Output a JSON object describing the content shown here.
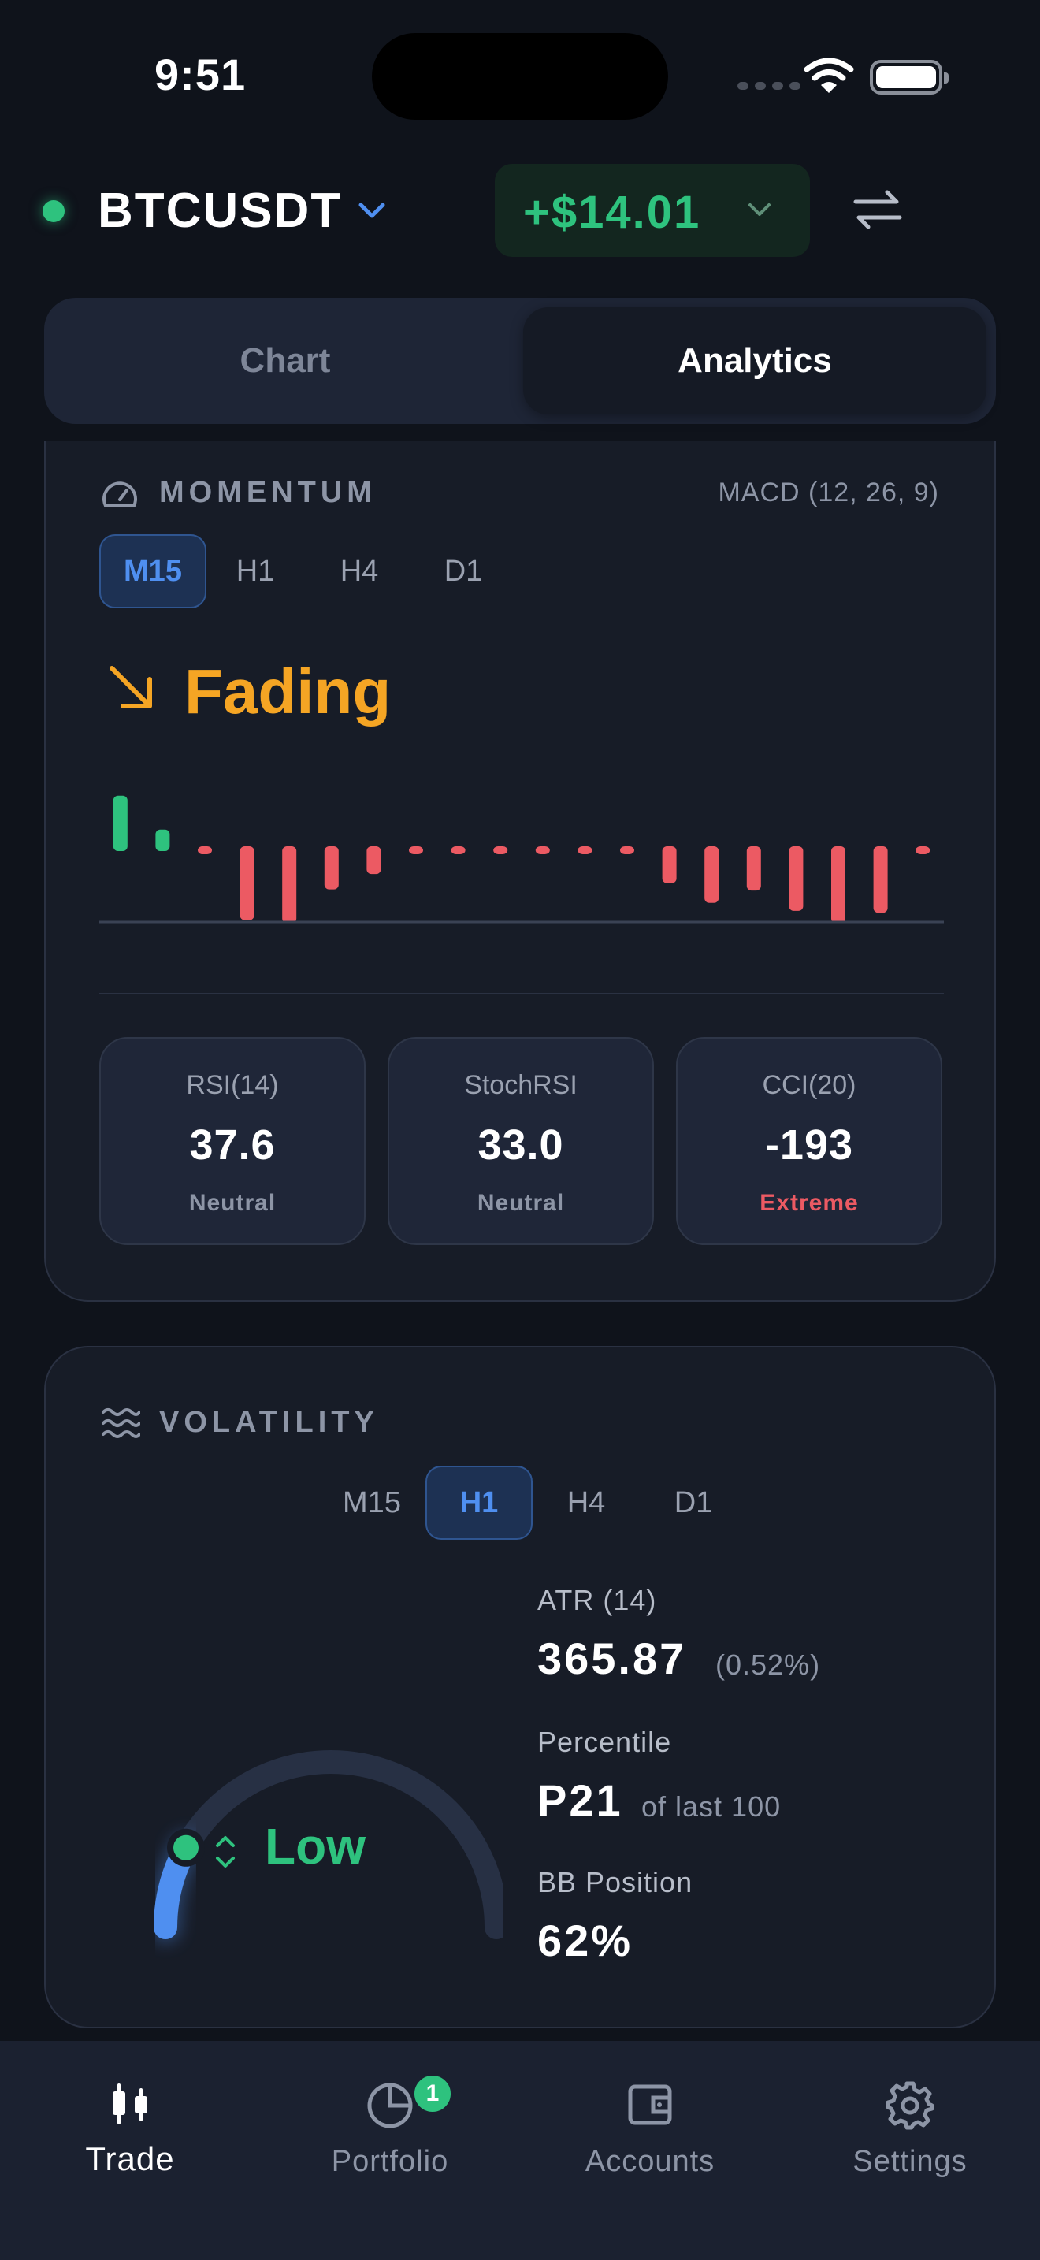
{
  "status_bar": {
    "time": "9:51"
  },
  "header": {
    "symbol": "BTCUSDT",
    "pnl": "+$14.01",
    "colors": {
      "live": "#2ec27e",
      "profit": "#2ec27e",
      "accent": "#4f8ff0"
    }
  },
  "segmented": {
    "items": [
      "Chart",
      "Analytics"
    ],
    "active": "Analytics"
  },
  "momentum": {
    "title": "MOMENTUM",
    "indicator": "MACD (12, 26, 9)",
    "timeframes": [
      "M15",
      "H1",
      "H4",
      "D1"
    ],
    "active_timeframe": "M15",
    "trend": "Fading",
    "trend_color": "#f5a524",
    "histogram": [
      0.9,
      0.35,
      -0.08,
      -1.2,
      -1.25,
      -0.7,
      -0.45,
      -0.08,
      -0.08,
      -0.08,
      -0.08,
      -0.08,
      -0.08,
      -0.6,
      -0.92,
      -0.72,
      -1.05,
      -1.25,
      -1.08,
      -0.08
    ],
    "stats": [
      {
        "label": "RSI(14)",
        "value": "37.6",
        "status": "Neutral"
      },
      {
        "label": "StochRSI",
        "value": "33.0",
        "status": "Neutral"
      },
      {
        "label": "CCI(20)",
        "value": "-193",
        "status": "Extreme"
      }
    ]
  },
  "volatility": {
    "title": "VOLATILITY",
    "timeframes": [
      "M15",
      "H1",
      "H4",
      "D1"
    ],
    "active_timeframe": "H1",
    "level": "Low",
    "gauge_fraction": 0.16,
    "atr_label": "ATR (14)",
    "atr_value": "365.87",
    "atr_pct": "(0.52%)",
    "percentile_label": "Percentile",
    "percentile_value": "P21",
    "percentile_sub": "of last 100",
    "bb_label": "BB Position",
    "bb_value": "62%"
  },
  "tabbar": {
    "items": [
      {
        "label": "Trade",
        "icon": "candlestick-icon"
      },
      {
        "label": "Portfolio",
        "icon": "pie-chart-icon",
        "badge": "1"
      },
      {
        "label": "Accounts",
        "icon": "wallet-icon"
      },
      {
        "label": "Settings",
        "icon": "gear-icon"
      }
    ],
    "active": "Trade"
  }
}
